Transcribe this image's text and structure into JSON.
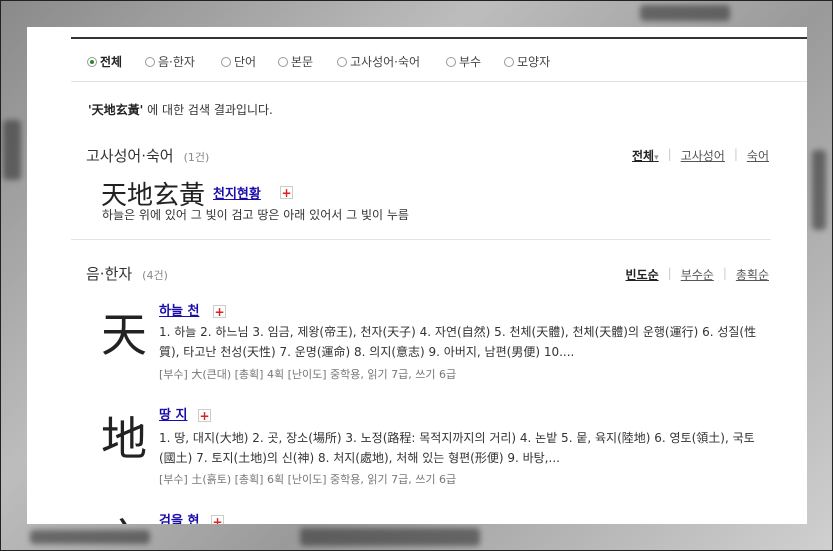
{
  "tabs": [
    {
      "label": "전체",
      "selected": true
    },
    {
      "label": "음·한자",
      "selected": false
    },
    {
      "label": "단어",
      "selected": false
    },
    {
      "label": "본문",
      "selected": false
    },
    {
      "label": "고사성어·숙어",
      "selected": false
    },
    {
      "label": "부수",
      "selected": false
    },
    {
      "label": "모양자",
      "selected": false
    }
  ],
  "result": {
    "query": "'天地玄黃'",
    "suffix": " 에 대한 검색 결과입니다."
  },
  "idiom_section": {
    "title": "고사성어·숙어",
    "count": "(1건)",
    "filters": [
      "전체",
      "고사성어",
      "숙어"
    ],
    "filter_arrow": "▾",
    "item": {
      "hanja": "天地玄黃",
      "reading": "천지현황",
      "plus": "+",
      "meaning": "하늘은 위에 있어 그 빛이 검고 땅은 아래 있어서 그 빛이 누름"
    }
  },
  "hanja_section": {
    "title": "음·한자",
    "count": "(4건)",
    "sorts": [
      "빈도순",
      "부수순",
      "총획순"
    ],
    "items": [
      {
        "char": "天",
        "reading": "하늘 천",
        "plus": "+",
        "meaning": "1. 하늘 2. 하느님 3. 임금, 제왕(帝王), 천자(天子) 4. 자연(自然) 5. 천체(天體), 천체(天體)의 운행(運行) 6. 성질(性質), 타고난 천성(天性) 7. 운명(運命) 8. 의지(意志) 9. 아버지, 남편(男便) 10....",
        "meta": "[부수] 大(큰대) [총획] 4획 [난이도] 중학용, 읽기 7급, 쓰기 6급"
      },
      {
        "char": "地",
        "reading": "땅 지",
        "plus": "+",
        "meaning": "1. 땅, 대지(大地) 2. 곳, 장소(場所) 3. 노정(路程: 목적지까지의 거리) 4. 논밭 5. 뭍, 육지(陸地) 6. 영토(領土), 국토(國土) 7. 토지(土地)의 신(神) 8. 처지(處地), 처해 있는 형편(形便) 9. 바탕,...",
        "meta": "[부수] 土(흙토) [총획] 6획 [난이도] 중학용, 읽기 7급, 쓰기 6급"
      },
      {
        "char": "玄",
        "reading": "검을 현",
        "plus": "+"
      }
    ]
  }
}
